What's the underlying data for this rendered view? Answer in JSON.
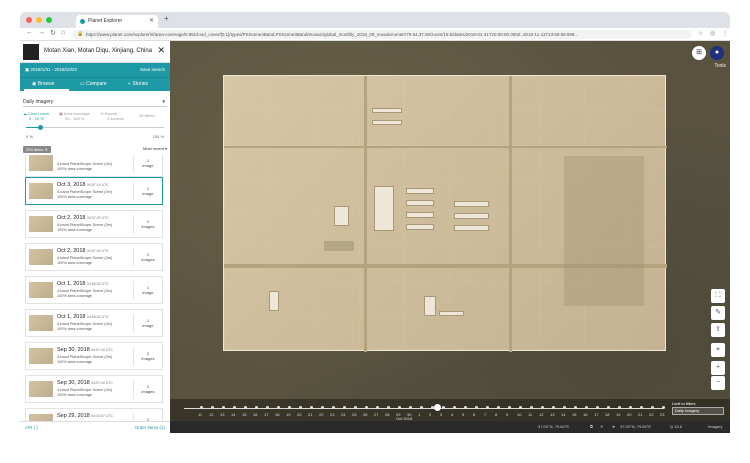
{
  "browser": {
    "tab_title": "Planet Explorer",
    "url": "https://www.planet.com/explorer/#/area-coverage/0.95/cloud_cover/[0,1]/types/PSScene4Band,PSScene3Band/mosaic/global_monthly_2018_09_mosaic/center/79.84,37.00/zoom/15.6/dates/2018-01-31T20:00:00.000Z..2018-11-11T23:59:59.999...",
    "colors": {
      "close": "#ff5f57",
      "minimize": "#febc2e",
      "maximize": "#28c840"
    }
  },
  "sidebar": {
    "place": "Motan Xian, Motan Diqu, Xinjiang, China",
    "date_range": "2018/1/31 - 2018/10/22",
    "save_label": "Save search",
    "tabs": [
      {
        "label": "Browse",
        "icon": "eye-icon"
      },
      {
        "label": "Compare",
        "icon": "compare-icon"
      },
      {
        "label": "Stories",
        "icon": "stories-icon"
      }
    ],
    "filter_label": "Daily imagery",
    "options": [
      {
        "line1": "Cloud cover",
        "line2": "0 - 10 %"
      },
      {
        "line1": "Area coverage",
        "line2": "95 - 100 %"
      },
      {
        "line1": "Source",
        "line2": "4 sources"
      },
      {
        "line1": "All filters",
        "line2": ""
      }
    ],
    "slider_min": "0 %",
    "slider_max": "100 %",
    "list_badge": "253 items",
    "sort_label": "Most recent",
    "items": [
      {
        "date": "",
        "time": "",
        "line1": "4-band PlanetScope Scene (3m)",
        "line2": "100% area coverage",
        "count": "1",
        "unit": "image"
      },
      {
        "date": "Oct 3, 2018",
        "time": "04:57:19 UTC",
        "line1": "4-band PlanetScope Scene (3m)",
        "line2": "100% area coverage",
        "count": "1",
        "unit": "image"
      },
      {
        "date": "Oct 2, 2018",
        "time": "04:57:20 UTC",
        "line1": "4-band PlanetScope Scene (3m)",
        "line2": "100% area coverage",
        "count": "2",
        "unit": "images"
      },
      {
        "date": "Oct 2, 2018",
        "time": "04:57:40 UTC",
        "line1": "4-band PlanetScope Scene (3m)",
        "line2": "100% area coverage",
        "count": "2",
        "unit": "images"
      },
      {
        "date": "Oct 1, 2018",
        "time": "04:56:02 UTC",
        "line1": "4-band PlanetScope Scene (3m)",
        "line2": "100% area coverage",
        "count": "1",
        "unit": "image"
      },
      {
        "date": "Oct 1, 2018",
        "time": "04:56:02 UTC",
        "line1": "4-band PlanetScope Scene (3m)",
        "line2": "100% area coverage",
        "count": "1",
        "unit": "image"
      },
      {
        "date": "Sep 30, 2018",
        "time": "04:57:40 UTC",
        "line1": "4-band PlanetScope Scene (3m)",
        "line2": "100% area coverage",
        "count": "2",
        "unit": "images"
      },
      {
        "date": "Sep 30, 2018",
        "time": "04:57:40 UTC",
        "line1": "4-band PlanetScope Scene (3m)",
        "line2": "100% area coverage",
        "count": "2",
        "unit": "images"
      },
      {
        "date": "Sep 29, 2018",
        "time": "04:42:07 UTC",
        "line1": "4-band PlanetScope Scene (3m)",
        "line2": "100% area coverage",
        "count": "2",
        "unit": "images"
      }
    ],
    "footer_api": "API { }",
    "footer_order": "Order items (1)"
  },
  "map": {
    "tools_label": "Tools",
    "timeline": {
      "days": [
        "11",
        "12",
        "13",
        "14",
        "15",
        "16",
        "17",
        "18",
        "19",
        "20",
        "21",
        "22",
        "23",
        "24",
        "25",
        "26",
        "27",
        "28",
        "29",
        "30",
        "1",
        "2",
        "3",
        "4",
        "5",
        "6",
        "7",
        "8",
        "9",
        "10",
        "11",
        "12",
        "13",
        "14",
        "15",
        "16",
        "17",
        "18",
        "19",
        "20",
        "21",
        "22",
        "23"
      ],
      "month_label": "Oct 2018",
      "filter_label": "Limit to filters",
      "select_value": "Daily imagery"
    },
    "status": {
      "coords": "37.00°N, 79.84°E",
      "scale": "37.00°N, 79.84°E",
      "zoom": "Q 15.6",
      "attribution": "Imagery"
    }
  }
}
